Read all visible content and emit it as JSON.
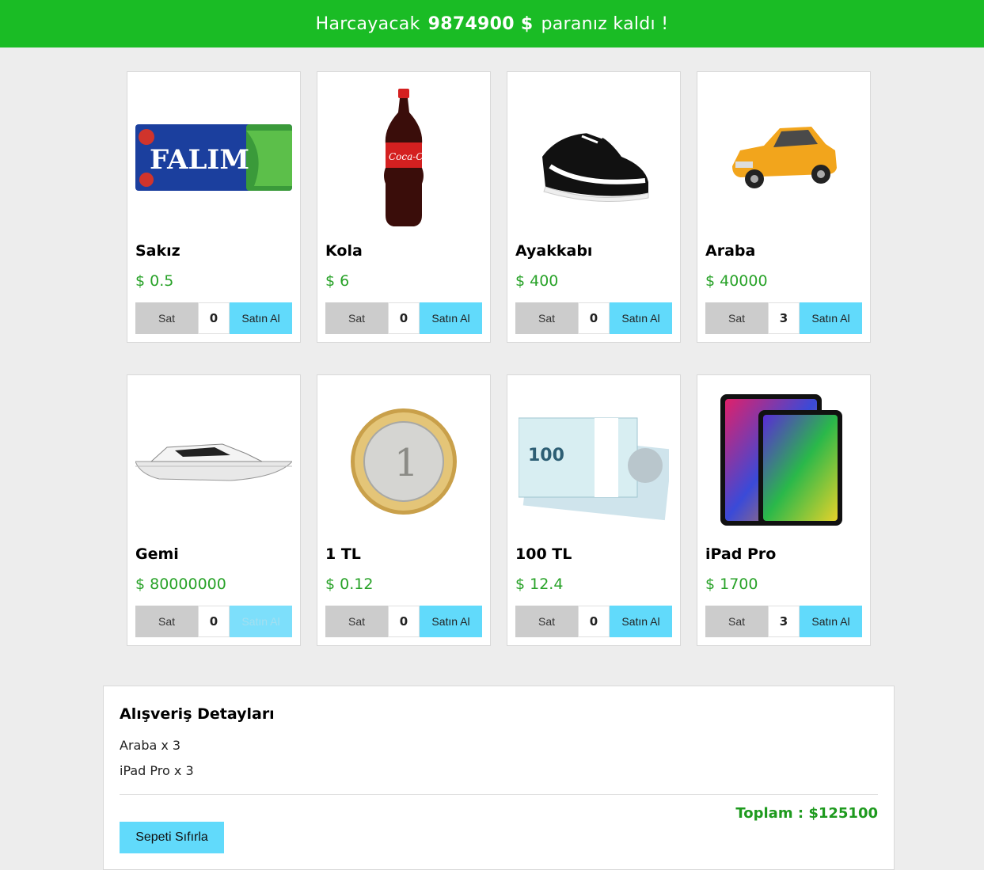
{
  "header": {
    "prefix": "Harcayacak",
    "amount": "9874900 $",
    "suffix": "paranız kaldı !"
  },
  "labels": {
    "sell": "Sat",
    "buy": "Satın Al"
  },
  "products": [
    {
      "name": "Sakız",
      "price": "$ 0.5",
      "qty": "0",
      "image": "gum-image"
    },
    {
      "name": "Kola",
      "price": "$ 6",
      "qty": "0",
      "image": "cola-bottle-image"
    },
    {
      "name": "Ayakkabı",
      "price": "$ 400",
      "qty": "0",
      "image": "shoe-image"
    },
    {
      "name": "Araba",
      "price": "$ 40000",
      "qty": "3",
      "image": "car-image"
    },
    {
      "name": "Gemi",
      "price": "$ 80000000",
      "qty": "0",
      "image": "boat-image",
      "buy_disabled": true
    },
    {
      "name": "1 TL",
      "price": "$ 0.12",
      "qty": "0",
      "image": "coin-image"
    },
    {
      "name": "100 TL",
      "price": "$ 12.4",
      "qty": "0",
      "image": "banknotes-image"
    },
    {
      "name": "iPad Pro",
      "price": "$ 1700",
      "qty": "3",
      "image": "tablet-image"
    }
  ],
  "gum_label": "FALIM",
  "coin_label": "1",
  "banknote_label": "100",
  "cart": {
    "title": "Alışveriş Detayları",
    "items": [
      "Araba x 3",
      "iPad Pro x 3"
    ],
    "total": "Toplam : $125100",
    "reset_label": "Sepeti Sıfırla"
  },
  "colors": {
    "header_bg": "#1abc25",
    "price": "#28a228",
    "buy_button": "#61dafb",
    "sell_button": "#cccccc"
  }
}
